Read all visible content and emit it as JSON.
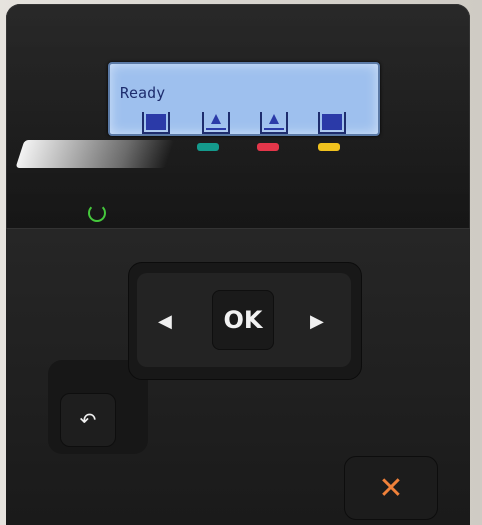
{
  "lcd": {
    "status_text": "Ready",
    "cartridges": [
      {
        "name": "black",
        "state": "full"
      },
      {
        "name": "cyan",
        "state": "low-warning"
      },
      {
        "name": "magenta",
        "state": "low-warning"
      },
      {
        "name": "yellow",
        "state": "full"
      }
    ]
  },
  "indicator_colors": {
    "cyan": "#149a8c",
    "magenta": "#e3364a",
    "yellow": "#f0c21e"
  },
  "controls": {
    "ok_label": "OK",
    "left_arrow": "◀",
    "right_arrow": "▶",
    "back_icon": "↶",
    "cancel_icon": "✕"
  },
  "colors": {
    "lcd_background": "#9ec0ee",
    "lcd_text": "#1e2d6e",
    "power_led": "#45c83c",
    "cancel_accent": "#f0813a"
  }
}
